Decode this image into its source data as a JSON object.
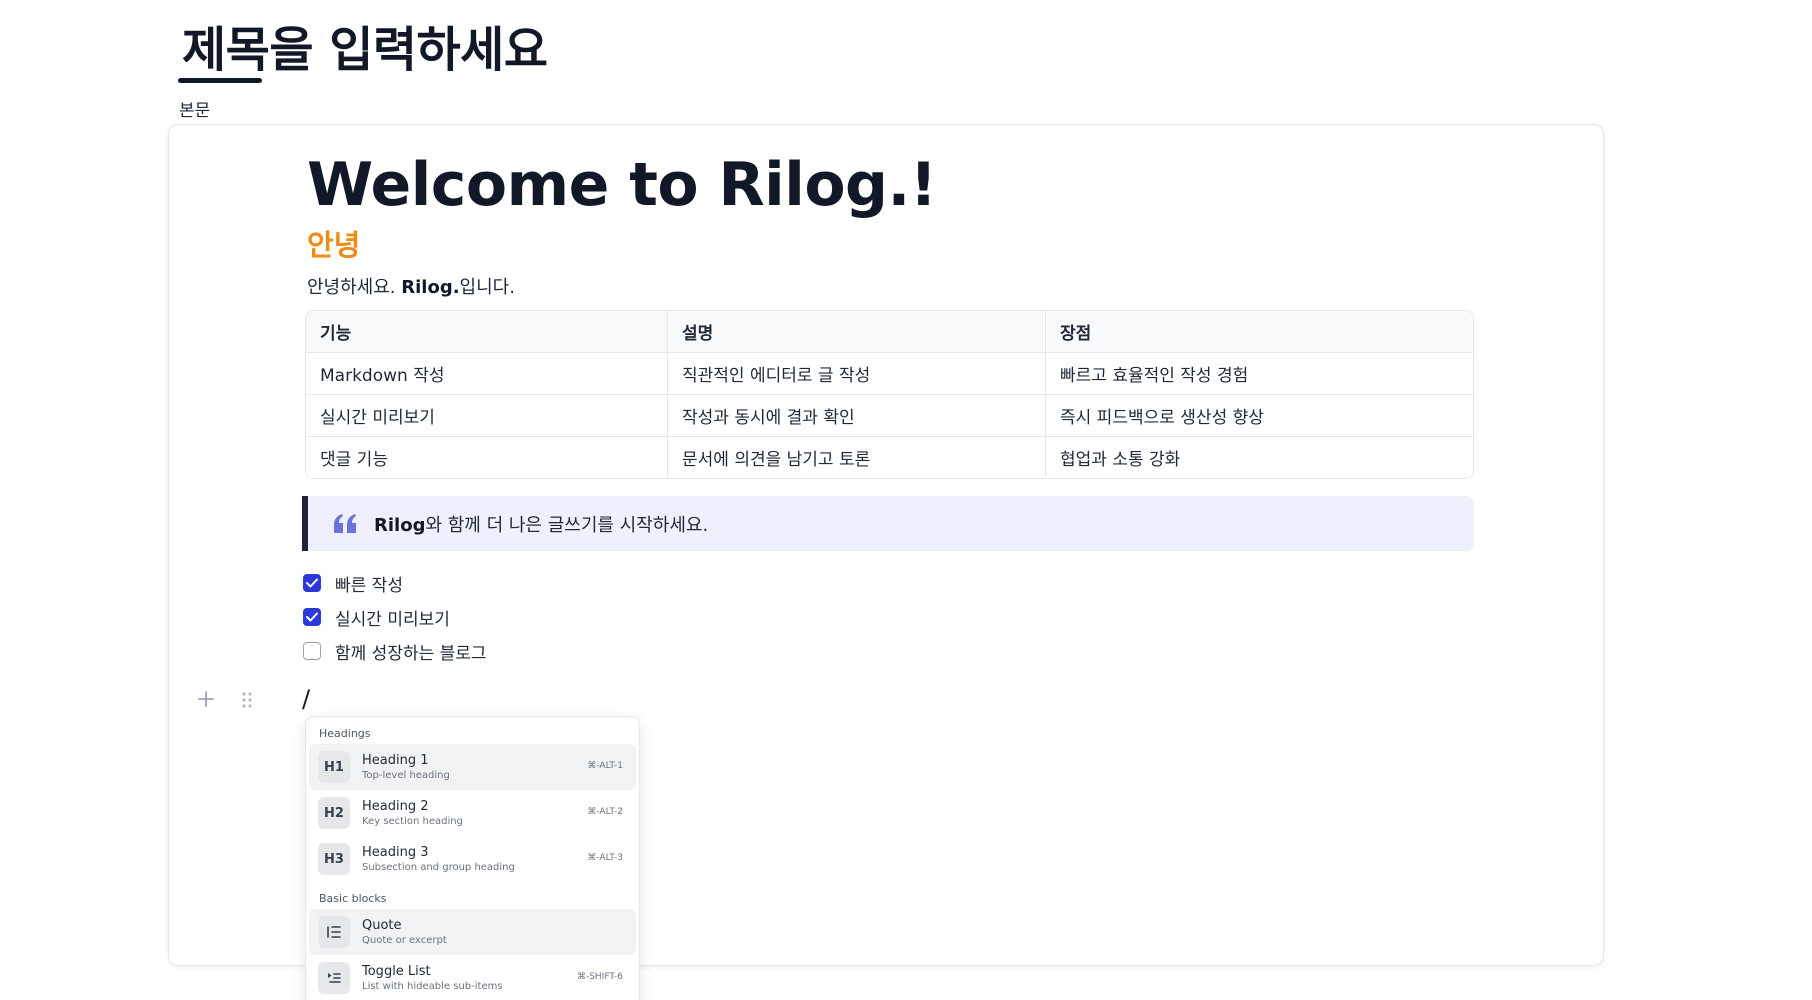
{
  "post": {
    "title": "제목을 입력하세요",
    "body_label": "본문"
  },
  "doc": {
    "heading1": "Welcome to Rilog.!",
    "heading2": "안녕",
    "paragraph_prefix": "안녕하세요. ",
    "paragraph_bold": "Rilog.",
    "paragraph_suffix": "입니다.",
    "table": {
      "headers": [
        "기능",
        "설명",
        "장점"
      ],
      "rows": [
        [
          "Markdown 작성",
          "직관적인 에디터로 글 작성",
          "빠르고 효율적인 작성 경험"
        ],
        [
          "실시간 미리보기",
          "작성과 동시에 결과 확인",
          "즉시 피드백으로 생산성 향상"
        ],
        [
          "댓글 기능",
          "문서에 의견을 남기고 토론",
          "협업과 소통 강화"
        ]
      ]
    },
    "quote_bold": "Rilog",
    "quote_rest": "와 함께 더 나은 글쓰기를 시작하세요.",
    "todos": [
      {
        "label": "빠른 작성",
        "checked": true
      },
      {
        "label": "실시간 미리보기",
        "checked": true
      },
      {
        "label": "함께 성장하는 블로그",
        "checked": false
      }
    ],
    "current_input": "/"
  },
  "slash_menu": {
    "sections": [
      {
        "title": "Headings",
        "items": [
          {
            "icon": "H1",
            "title": "Heading 1",
            "subtitle": "Top-level heading",
            "shortcut": "⌘-ALT-1",
            "active": true
          },
          {
            "icon": "H2",
            "title": "Heading 2",
            "subtitle": "Key section heading",
            "shortcut": "⌘-ALT-2",
            "active": false
          },
          {
            "icon": "H3",
            "title": "Heading 3",
            "subtitle": "Subsection and group heading",
            "shortcut": "⌘-ALT-3",
            "active": false
          }
        ]
      },
      {
        "title": "Basic blocks",
        "items": [
          {
            "icon": "quote-lines-icon",
            "title": "Quote",
            "subtitle": "Quote or excerpt",
            "shortcut": "",
            "active": true
          },
          {
            "icon": "toggle-list-icon",
            "title": "Toggle List",
            "subtitle": "List with hideable sub-items",
            "shortcut": "⌘-SHIFT-6",
            "active": false
          }
        ]
      }
    ]
  },
  "colors": {
    "accent_orange": "#f08c16",
    "checkbox_blue": "#2b39d6",
    "quote_bg": "#eef0fb",
    "quote_bar": "#1e2337"
  }
}
